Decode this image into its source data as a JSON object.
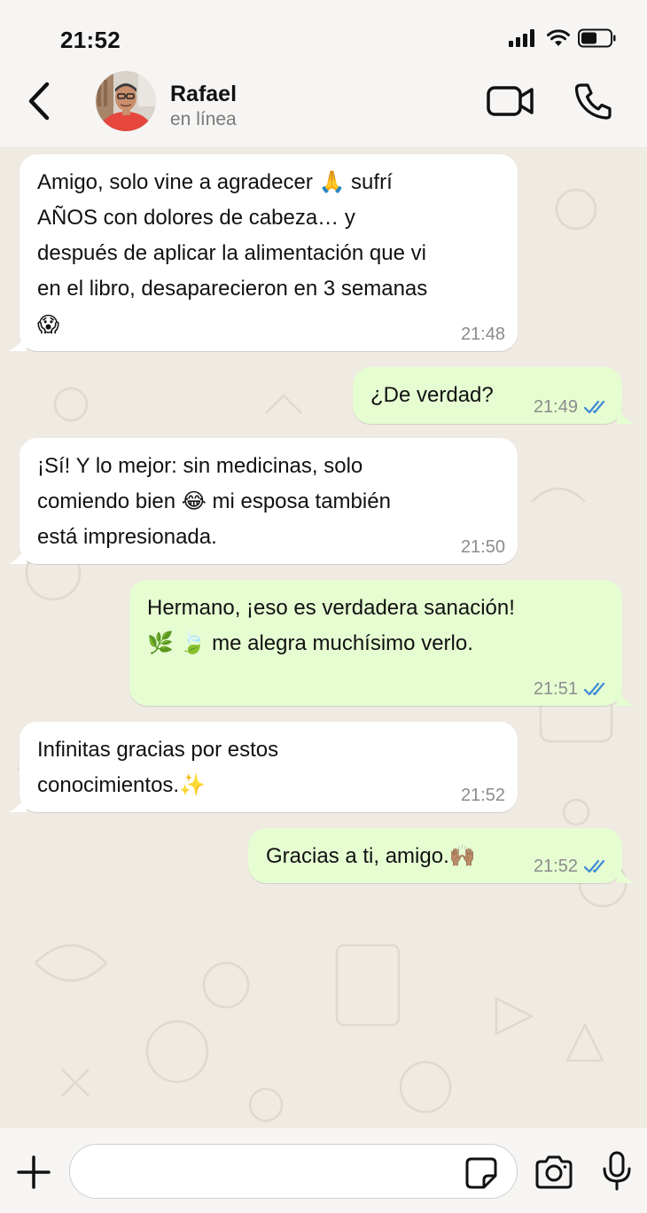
{
  "status_bar": {
    "time": "21:52",
    "icons": [
      "signal-icon",
      "wifi-icon",
      "battery-icon"
    ]
  },
  "header": {
    "back_icon": "chevron-left-icon",
    "contact_name": "Rafael",
    "contact_status": "en línea",
    "actions": [
      "video-call-icon",
      "phone-icon"
    ]
  },
  "messages": [
    {
      "direction": "incoming",
      "lines": [
        "Amigo, solo vine a agradecer 🙏 sufrí",
        "AÑOS con dolores de cabeza… y",
        "después de aplicar la alimentación que vi",
        "en el libro, desaparecieron en 3 semanas",
        "😱"
      ],
      "time": "21:48"
    },
    {
      "direction": "outgoing",
      "lines": [
        "¿De verdad?"
      ],
      "time": "21:49",
      "status": "read"
    },
    {
      "direction": "incoming",
      "lines": [
        "¡Sí! Y lo mejor: sin medicinas, solo",
        "comiendo bien 😂 mi esposa también",
        "está impresionada."
      ],
      "time": "21:50"
    },
    {
      "direction": "outgoing",
      "lines": [
        "Hermano, ¡eso es verdadera sanación!",
        "🌿 🍃 me alegra muchísimo verlo."
      ],
      "time": "21:51",
      "status": "read"
    },
    {
      "direction": "incoming",
      "lines": [
        "Infinitas gracias por estos",
        "conocimientos.✨"
      ],
      "time": "21:52"
    },
    {
      "direction": "outgoing",
      "lines": [
        "Gracias a ti, amigo.🙌🏽"
      ],
      "time": "21:52",
      "status": "read"
    }
  ],
  "composer": {
    "input_value": "",
    "icons": [
      "plus-icon",
      "sticker-icon",
      "camera-icon",
      "microphone-icon"
    ]
  },
  "colors": {
    "incoming_bubble": "#ffffff",
    "outgoing_bubble": "#e6fdd2",
    "chat_background": "#efeae2",
    "read_ticks": "#3d8bd6",
    "timestamp": "#8c8c8c"
  }
}
